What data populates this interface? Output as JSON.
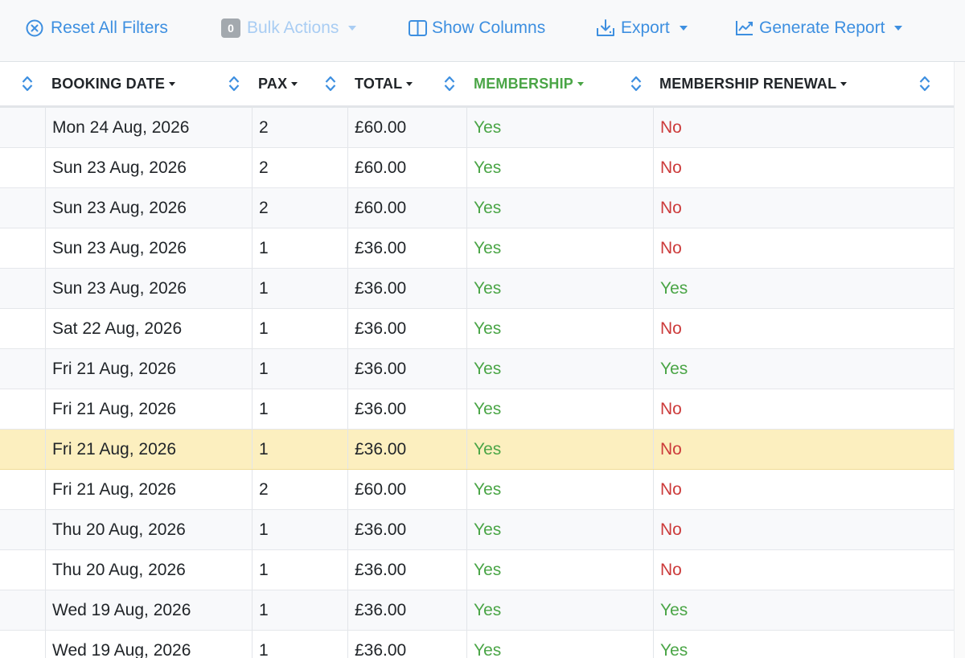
{
  "toolbar": {
    "reset_label": "Reset All Filters",
    "bulk_count": "0",
    "bulk_label": "Bulk Actions",
    "show_columns_label": "Show Columns",
    "export_label": "Export",
    "report_label": "Generate Report",
    "icons": [
      "circle-x-icon",
      "columns-icon",
      "download-icon",
      "chart-line-icon"
    ]
  },
  "columns": [
    {
      "label": "BOOKING DATE"
    },
    {
      "label": "PAX"
    },
    {
      "label": "TOTAL"
    },
    {
      "label": "MEMBERSHIP"
    },
    {
      "label": "MEMBERSHIP RENEWAL"
    }
  ],
  "colors": {
    "accent": "#3d8fe0",
    "yes": "#4aa546",
    "no": "#cc3a3a",
    "highlight_row": "#fcefbf"
  },
  "rows": [
    {
      "date": "Mon 24 Aug, 2026",
      "pax": "2",
      "total": "£60.00",
      "membership": "Yes",
      "renewal": "No"
    },
    {
      "date": "Sun 23 Aug, 2026",
      "pax": "2",
      "total": "£60.00",
      "membership": "Yes",
      "renewal": "No"
    },
    {
      "date": "Sun 23 Aug, 2026",
      "pax": "2",
      "total": "£60.00",
      "membership": "Yes",
      "renewal": "No"
    },
    {
      "date": "Sun 23 Aug, 2026",
      "pax": "1",
      "total": "£36.00",
      "membership": "Yes",
      "renewal": "No"
    },
    {
      "date": "Sun 23 Aug, 2026",
      "pax": "1",
      "total": "£36.00",
      "membership": "Yes",
      "renewal": "Yes"
    },
    {
      "date": "Sat 22 Aug, 2026",
      "pax": "1",
      "total": "£36.00",
      "membership": "Yes",
      "renewal": "No"
    },
    {
      "date": "Fri 21 Aug, 2026",
      "pax": "1",
      "total": "£36.00",
      "membership": "Yes",
      "renewal": "Yes"
    },
    {
      "date": "Fri 21 Aug, 2026",
      "pax": "1",
      "total": "£36.00",
      "membership": "Yes",
      "renewal": "No"
    },
    {
      "date": "Fri 21 Aug, 2026",
      "pax": "1",
      "total": "£36.00",
      "membership": "Yes",
      "renewal": "No",
      "highlighted": true
    },
    {
      "date": "Fri 21 Aug, 2026",
      "pax": "2",
      "total": "£60.00",
      "membership": "Yes",
      "renewal": "No"
    },
    {
      "date": "Thu 20 Aug, 2026",
      "pax": "1",
      "total": "£36.00",
      "membership": "Yes",
      "renewal": "No"
    },
    {
      "date": "Thu 20 Aug, 2026",
      "pax": "1",
      "total": "£36.00",
      "membership": "Yes",
      "renewal": "No"
    },
    {
      "date": "Wed 19 Aug, 2026",
      "pax": "1",
      "total": "£36.00",
      "membership": "Yes",
      "renewal": "Yes"
    },
    {
      "date": "Wed 19 Aug, 2026",
      "pax": "1",
      "total": "£36.00",
      "membership": "Yes",
      "renewal": "Yes"
    }
  ]
}
